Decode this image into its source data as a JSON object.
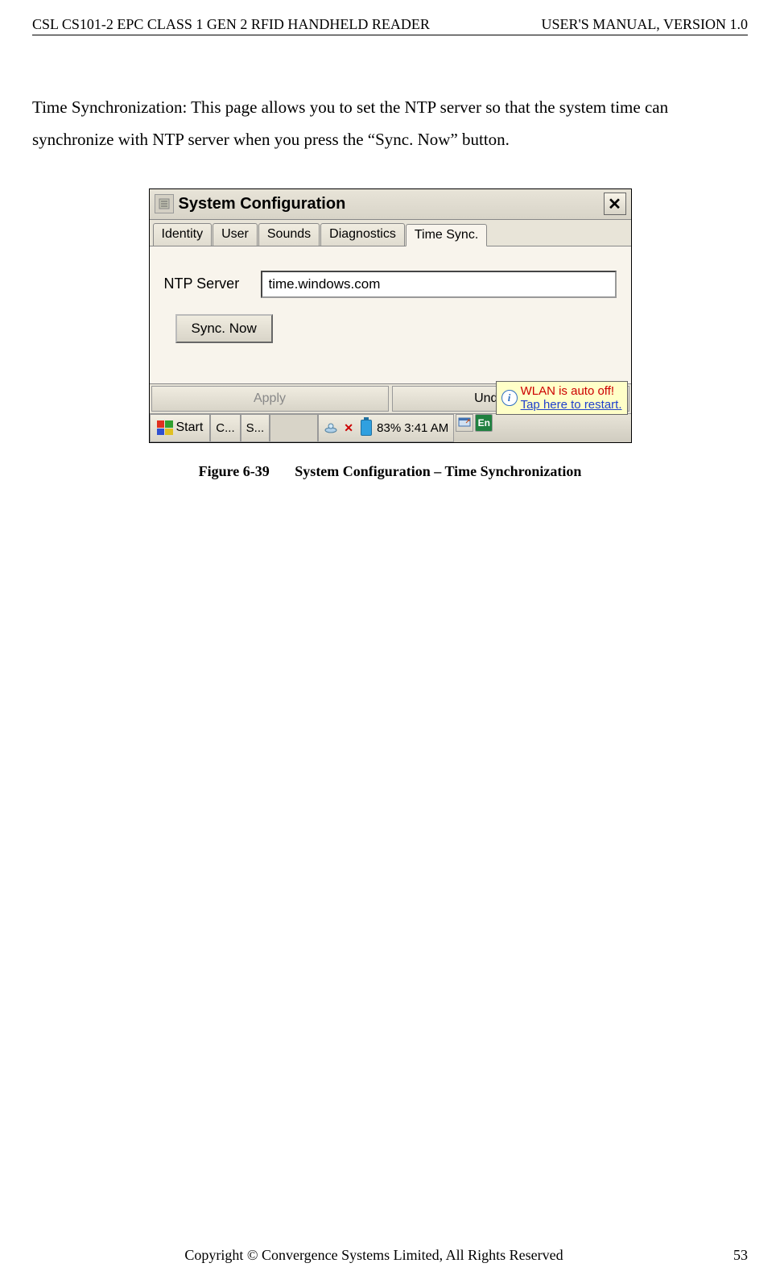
{
  "header": {
    "left": "CSL CS101-2 EPC CLASS 1 GEN 2 RFID HANDHELD READER",
    "right": "USER'S  MANUAL,  VERSION  1.0"
  },
  "body_text": "Time Synchronization: This page allows you to set the NTP server so that the system time can synchronize with NTP server when you press the “Sync. Now” button.",
  "screenshot": {
    "window_title": "System Configuration",
    "close_label": "✕",
    "tabs": {
      "identity": "Identity",
      "user": "User",
      "sounds": "Sounds",
      "diagnostics": "Diagnostics",
      "timesync": "Time Sync."
    },
    "ntp_label": "NTP Server",
    "ntp_value": "time.windows.com",
    "sync_button": "Sync. Now",
    "apply_button": "Apply",
    "undo_button": "Undo Chang",
    "tooltip": {
      "line1": "WLAN is auto off!",
      "line2": "Tap here to restart."
    },
    "taskbar": {
      "start": "Start",
      "item1": "C...",
      "item2": "S...",
      "battery_pct": "83%",
      "time": "3:41 AM",
      "en": "En"
    }
  },
  "figure_caption": {
    "number": "Figure 6-39",
    "text": "System Configuration – Time Synchronization"
  },
  "footer": {
    "copyright": "Copyright © Convergence Systems Limited, All Rights Reserved",
    "page": "53"
  }
}
